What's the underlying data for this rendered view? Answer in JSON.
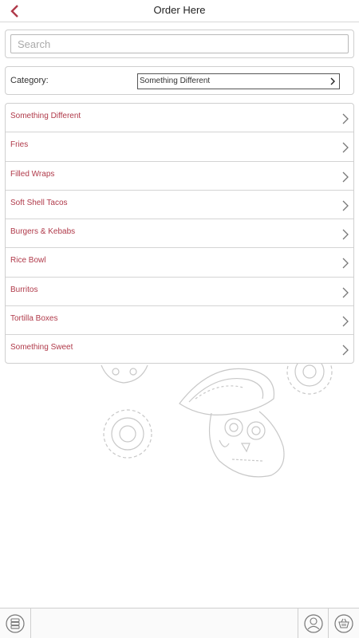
{
  "header": {
    "title": "Order Here",
    "back_icon": "chevron-left-icon",
    "accent": "#b03a4a"
  },
  "search": {
    "placeholder": "Search",
    "value": ""
  },
  "category": {
    "label": "Category:",
    "selected": "Something Different"
  },
  "menu": {
    "items": [
      {
        "label": "Something Different"
      },
      {
        "label": "Fries"
      },
      {
        "label": "Filled Wraps"
      },
      {
        "label": "Soft Shell Tacos"
      },
      {
        "label": "Burgers & Kebabs"
      },
      {
        "label": "Rice Bowl"
      },
      {
        "label": "Burritos"
      },
      {
        "label": "Tortilla Boxes"
      },
      {
        "label": "Something Sweet"
      }
    ]
  },
  "footer": {
    "menu_icon": "stacked-layers-icon",
    "account_icon": "user-icon",
    "basket_icon": "basket-icon"
  }
}
